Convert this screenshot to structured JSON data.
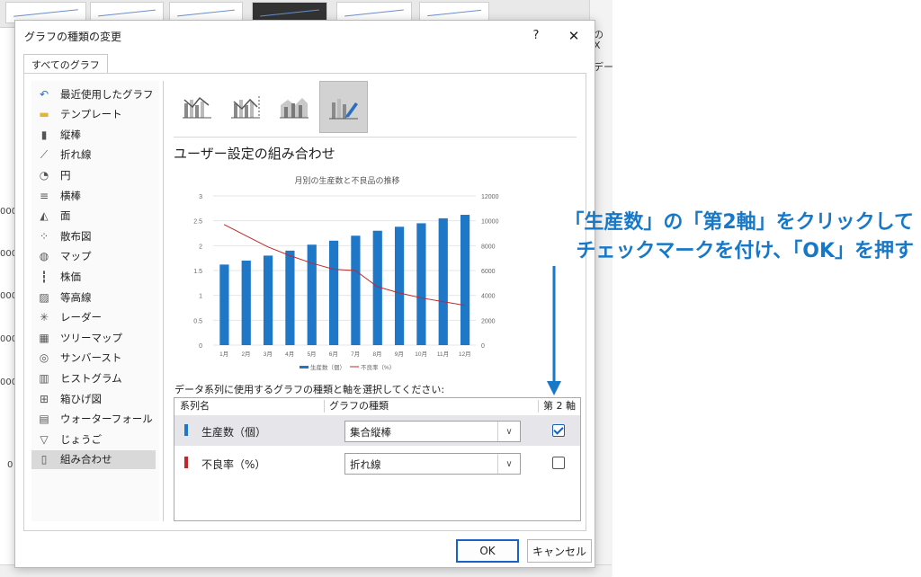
{
  "dialog": {
    "title": "グラフの種類の変更",
    "help": "?",
    "close": "✕",
    "tab": "すべてのグラフ"
  },
  "sidebar": {
    "items": [
      {
        "label": "最近使用したグラフ",
        "icon": "recent-icon"
      },
      {
        "label": "テンプレート",
        "icon": "folder-icon"
      },
      {
        "label": "縦棒",
        "icon": "column-chart-icon"
      },
      {
        "label": "折れ線",
        "icon": "line-chart-icon"
      },
      {
        "label": "円",
        "icon": "pie-chart-icon"
      },
      {
        "label": "横棒",
        "icon": "bar-chart-icon"
      },
      {
        "label": "面",
        "icon": "area-chart-icon"
      },
      {
        "label": "散布図",
        "icon": "scatter-chart-icon"
      },
      {
        "label": "マップ",
        "icon": "map-icon"
      },
      {
        "label": "株価",
        "icon": "stock-chart-icon"
      },
      {
        "label": "等高線",
        "icon": "surface-chart-icon"
      },
      {
        "label": "レーダー",
        "icon": "radar-chart-icon"
      },
      {
        "label": "ツリーマップ",
        "icon": "treemap-icon"
      },
      {
        "label": "サンバースト",
        "icon": "sunburst-icon"
      },
      {
        "label": "ヒストグラム",
        "icon": "histogram-icon"
      },
      {
        "label": "箱ひげ図",
        "icon": "box-whisker-icon"
      },
      {
        "label": "ウォーターフォール",
        "icon": "waterfall-icon"
      },
      {
        "label": "じょうご",
        "icon": "funnel-icon"
      },
      {
        "label": "組み合わせ",
        "icon": "combo-chart-icon"
      }
    ],
    "selected_index": 18
  },
  "main": {
    "section_title": "ユーザー設定の組み合わせ",
    "prompt": "データ系列に使用するグラフの種類と軸を選択してください:",
    "table": {
      "headers": [
        "系列名",
        "グラフの種類",
        "第 2 軸"
      ],
      "rows": [
        {
          "name": "生産数（個）",
          "type": "集合縦棒",
          "secondary": true,
          "color": "#1f77c8"
        },
        {
          "name": "不良率（%）",
          "type": "折れ線",
          "secondary": false,
          "color": "#c0282b"
        }
      ]
    }
  },
  "chart_data": {
    "type": "combo",
    "title": "月別の生産数と不良品の推移",
    "categories": [
      "1月",
      "2月",
      "3月",
      "4月",
      "5月",
      "6月",
      "7月",
      "8月",
      "9月",
      "10月",
      "11月",
      "12月"
    ],
    "series": [
      {
        "name": "生産数（個）",
        "kind": "bar",
        "axis": "primary",
        "color": "#1f77c8",
        "values": [
          1.62,
          1.7,
          1.8,
          1.9,
          2.02,
          2.1,
          2.2,
          2.3,
          2.38,
          2.45,
          2.55,
          2.62
        ]
      },
      {
        "name": "不良率（%）",
        "kind": "line",
        "axis": "secondary",
        "color": "#c0282b",
        "values": [
          9.7,
          8.8,
          7.9,
          7.2,
          6.6,
          6.1,
          6.0,
          4.7,
          4.2,
          3.8,
          3.5,
          3.2
        ]
      }
    ],
    "ylim": [
      0,
      3
    ],
    "yticks": [
      "0",
      "0.5",
      "1",
      "1.5",
      "2",
      "2.5",
      "3"
    ],
    "y2lim": [
      0,
      12
    ],
    "y2ticks": [
      "0",
      "2000",
      "4000",
      "6000",
      "8000",
      "10000",
      "12000"
    ],
    "legend": {
      "placement": "bottom",
      "labels": [
        "生産数（個）",
        "不良率（%）"
      ]
    },
    "grid": true
  },
  "buttons": {
    "ok": "OK",
    "cancel": "キャンセル"
  },
  "annotation": {
    "line1": "「生産数」の「第2軸」をクリックして",
    "line2": "チェックマークを付け、「OK」を押す",
    "color": "#1878c8"
  },
  "background": {
    "right_texts": [
      "の",
      "Ⅹ",
      "デー"
    ],
    "left_numbers": [
      "000",
      "000",
      "000",
      "000",
      "000",
      "0"
    ]
  }
}
